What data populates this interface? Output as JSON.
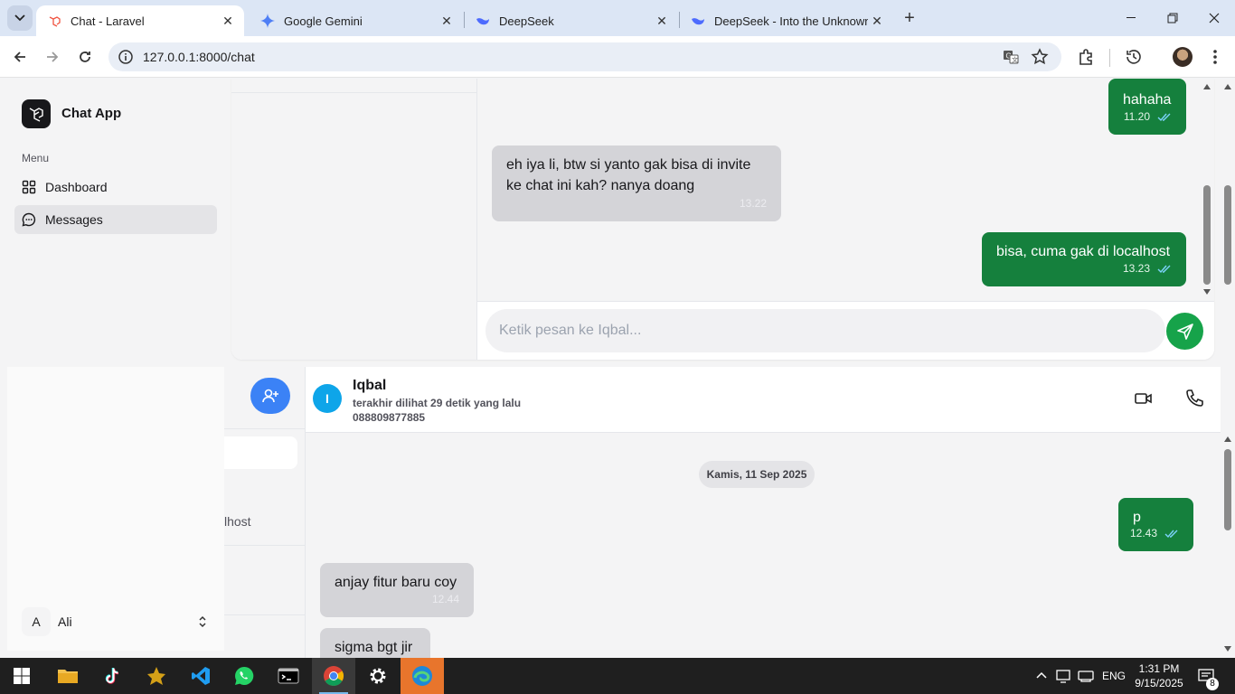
{
  "browser": {
    "tabs": [
      {
        "title": "Chat - Laravel",
        "active": true
      },
      {
        "title": "Google Gemini",
        "active": false
      },
      {
        "title": "DeepSeek",
        "active": false
      },
      {
        "title": "DeepSeek - Into the Unknown",
        "active": false
      }
    ],
    "url": "127.0.0.1:8000/chat"
  },
  "sidebar": {
    "brand": "Chat App",
    "menu_label": "Menu",
    "items": [
      {
        "label": "Dashboard",
        "icon": "grid-icon"
      },
      {
        "label": "Messages",
        "icon": "message-icon",
        "active": true
      }
    ],
    "user": {
      "initial": "A",
      "name": "Ali"
    }
  },
  "upper_chat": {
    "messages": [
      {
        "text": "hahaha",
        "time": "11.20",
        "direction": "out",
        "read": true
      },
      {
        "text": "eh iya li, btw si yanto gak bisa di invite ke chat ini kah? nanya doang",
        "time": "13.22",
        "direction": "in"
      },
      {
        "text": "bisa, cuma gak di localhost",
        "time": "13.23",
        "direction": "out",
        "read": true
      }
    ],
    "input_placeholder": "Ketik pesan ke Iqbal..."
  },
  "lower_panel": {
    "list_snippet": "lhost",
    "contact": {
      "initial": "I",
      "name": "Iqbal",
      "last_seen": "terakhir dilihat 29 detik yang lalu",
      "phone": "088809877885"
    },
    "date_separator": "Kamis, 11 Sep 2025",
    "messages": [
      {
        "text": "p",
        "time": "12.43",
        "direction": "out",
        "read": true
      },
      {
        "text": "anjay fitur baru coy",
        "time": "12.44",
        "direction": "in"
      },
      {
        "text": "sigma bgt jir",
        "time": "",
        "direction": "in"
      }
    ]
  },
  "taskbar": {
    "language": "ENG",
    "time": "1:31 PM",
    "date": "9/15/2025",
    "notification_count": "8"
  },
  "colors": {
    "outgoing_bubble": "#15803d",
    "incoming_bubble": "#d4d4d8",
    "send_button": "#16a34a",
    "add_contact_button": "#3b82f6",
    "contact_avatar": "#0ea5e9"
  }
}
